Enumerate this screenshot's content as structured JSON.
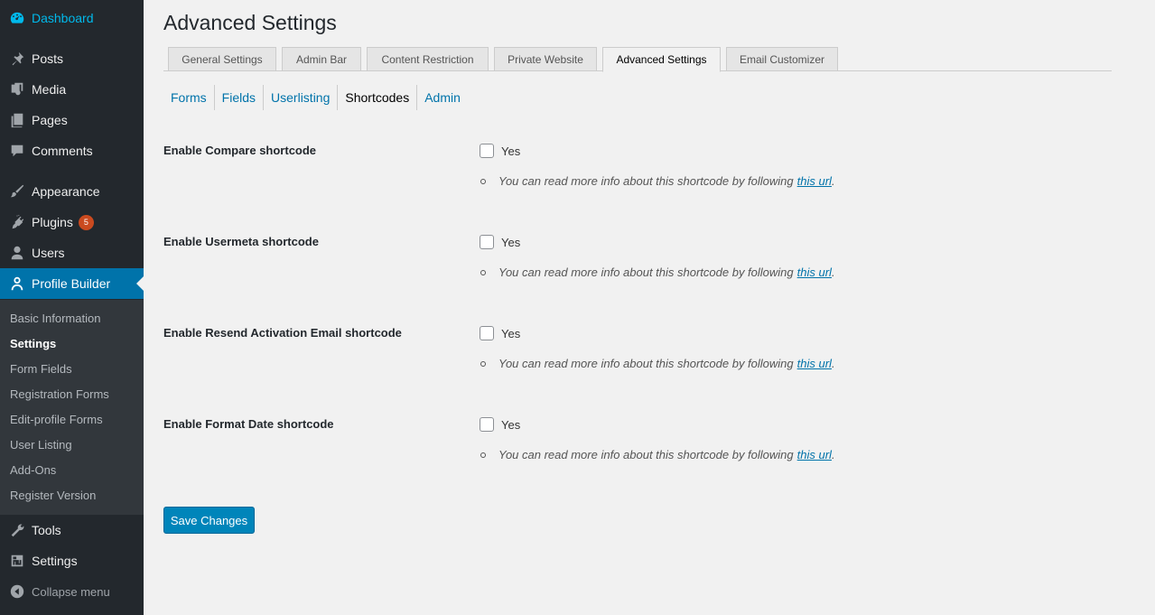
{
  "sidebar": {
    "items": [
      {
        "label": "Dashboard",
        "icon": "dashboard-icon"
      },
      {
        "label": "Posts",
        "icon": "pin-icon"
      },
      {
        "label": "Media",
        "icon": "media-icon"
      },
      {
        "label": "Pages",
        "icon": "pages-icon"
      },
      {
        "label": "Comments",
        "icon": "comment-icon"
      },
      {
        "label": "Appearance",
        "icon": "brush-icon"
      },
      {
        "label": "Plugins",
        "icon": "plug-icon",
        "badge": "5"
      },
      {
        "label": "Users",
        "icon": "user-icon"
      },
      {
        "label": "Profile Builder",
        "icon": "profile-icon"
      },
      {
        "label": "Tools",
        "icon": "wrench-icon"
      },
      {
        "label": "Settings",
        "icon": "settings-icon"
      },
      {
        "label": "Collapse menu",
        "icon": "collapse-icon"
      }
    ],
    "submenu": [
      "Basic Information",
      "Settings",
      "Form Fields",
      "Registration Forms",
      "Edit-profile Forms",
      "User Listing",
      "Add-Ons",
      "Register Version"
    ]
  },
  "main": {
    "title": "Advanced Settings",
    "tabs": [
      "General Settings",
      "Admin Bar",
      "Content Restriction",
      "Private Website",
      "Advanced Settings",
      "Email Customizer"
    ],
    "subtabs": [
      "Forms",
      "Fields",
      "Userlisting",
      "Shortcodes",
      "Admin"
    ],
    "rows": [
      {
        "label": "Enable Compare shortcode",
        "option": "Yes",
        "desc": "You can read more info about this shortcode by following",
        "link": "this url",
        "end": "."
      },
      {
        "label": "Enable Usermeta shortcode",
        "option": "Yes",
        "desc": "You can read more info about this shortcode by following",
        "link": "this url",
        "end": "."
      },
      {
        "label": "Enable Resend Activation Email shortcode",
        "option": "Yes",
        "desc": "You can read more info about this shortcode by following",
        "link": "this url",
        "end": "."
      },
      {
        "label": "Enable Format Date shortcode",
        "option": "Yes",
        "desc": "You can read more info about this shortcode by following",
        "link": "this url",
        "end": "."
      }
    ],
    "save_label": "Save Changes"
  },
  "colors": {
    "sidebar_bg": "#23282d",
    "submenu_bg": "#32373c",
    "accent": "#0073aa",
    "button": "#0085ba",
    "badge": "#ca4a1f"
  }
}
